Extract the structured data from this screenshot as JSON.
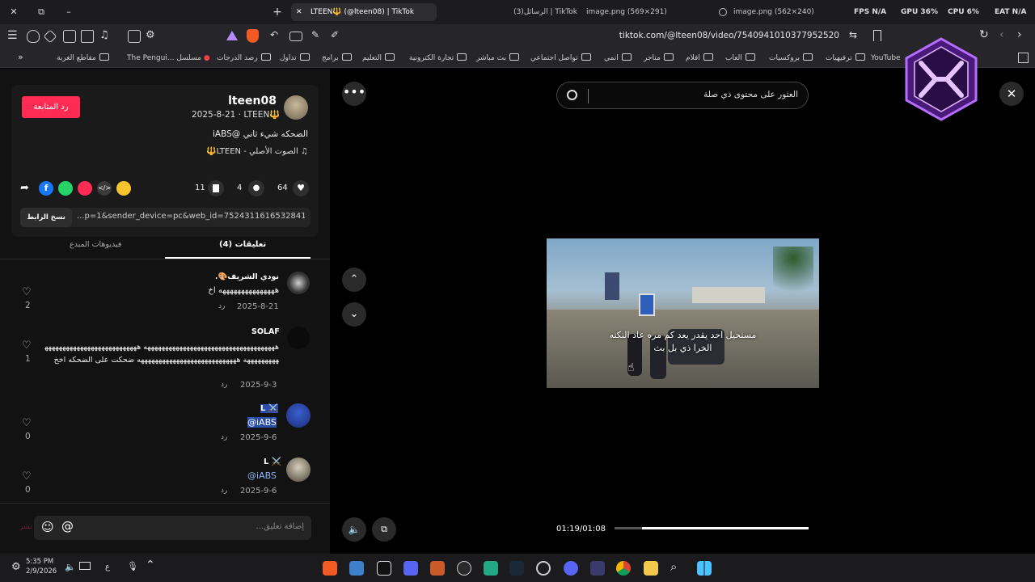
{
  "tabs": [
    {
      "label": "LTEEN🔱 (@lteen08) | TikTok",
      "active": true
    },
    {
      "label": "(3)الرسائل | TikTok",
      "active": false
    },
    {
      "label": "image.png (569×291)",
      "active": false
    },
    {
      "label": "image.png (562×240)",
      "active": false
    }
  ],
  "overlay_stats": {
    "fps": "FPS N/A",
    "gpu": "GPU 36%",
    "cpu": "CPU 6%",
    "eat": "EAT N/A"
  },
  "address_bar": {
    "url": "tiktok.com/@lteen08/video/7540941010377952520"
  },
  "bookmarks": [
    "YouTube",
    "ترفيهيات",
    "بروكسيات",
    "العاب",
    "افلام",
    "متاجر",
    "انمي",
    "تواصل اجتماعي",
    "بث مباشر",
    "تجارة الكترونية",
    "التعليم",
    "برامج",
    "تداول",
    "رصد الدرجات",
    "The Pengui... مسلسل",
    "مقاطع الغربة"
  ],
  "profile": {
    "display_name": "lteen08",
    "username": "LTEEN🔱",
    "date": "2025-8-21",
    "follow_label": "رد المتابعة",
    "caption": "الضحكه شيء ثاني @iABS",
    "sound": "الصوت الأصلي - LTEEN🔱"
  },
  "stats": {
    "likes": "64",
    "comments": "4",
    "saves": "11"
  },
  "share": {
    "link": "...p=1&sender_device=pc&web_id=7524311616532841992",
    "copy_label": "نسخ الرابط"
  },
  "content_tabs": {
    "comments": "تعليقات (4)",
    "creator_videos": "فيديوهات المبدع"
  },
  "comments": [
    {
      "user": "نودي الشريف🎨.",
      "text": "هههههههههههههههه اخ",
      "date": "2025-8-21",
      "reply": "رد",
      "likes": "2"
    },
    {
      "user": "SOLAF",
      "text": "هههههههههههههههههههههههههههههههههههههه ههههههههههههههههههههههههههههههههههههه ههههههههههههههههههههههههههههه ضحكت على الضحكه اخخ",
      "date": "2025-9-3",
      "reply": "رد",
      "likes": "1"
    },
    {
      "user": "L ⚔️",
      "text": "@iABS",
      "date": "2025-9-6",
      "reply": "رد",
      "likes": "0"
    },
    {
      "user": "L ⚔️",
      "text": "@iABS",
      "date": "2025-9-6",
      "reply": "رد",
      "likes": "0"
    }
  ],
  "comment_input": {
    "placeholder": "إضافة تعليق...",
    "post_label": "نشر"
  },
  "player": {
    "search_placeholder": "العثور على محتوى ذي صلة",
    "subtitle_line1": "مستحيل احد يقدر يعد كم مره عاد النكته",
    "subtitle_line2": "الخرا ذي بل بث",
    "time": "01:19/01:08",
    "progress": 0.14
  },
  "taskbar": {
    "time": "5:35 PM",
    "date": "2/9/2026",
    "lang": "ع"
  },
  "colors": {
    "accent": "#fe2c55",
    "link": "#8ab4f8",
    "bg": "#121212"
  }
}
